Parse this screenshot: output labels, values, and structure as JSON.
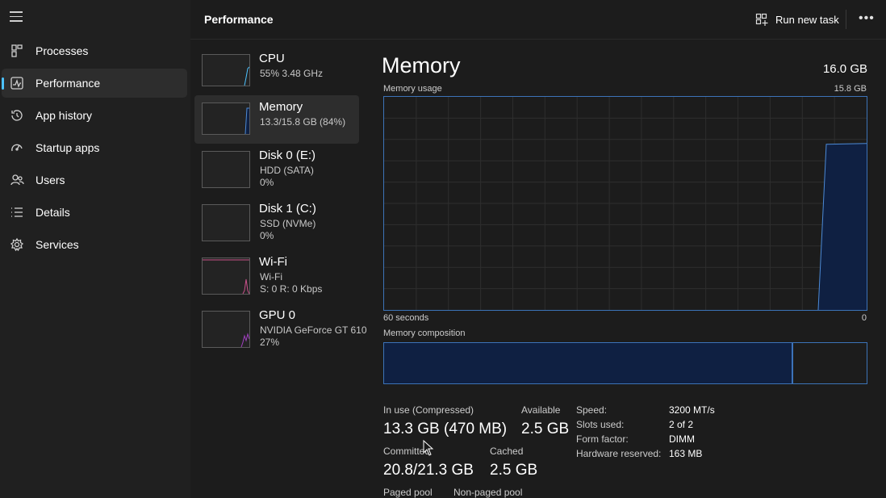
{
  "nav": {
    "items": [
      {
        "label": "Processes",
        "icon": "processes-icon"
      },
      {
        "label": "Performance",
        "icon": "performance-icon",
        "active": true
      },
      {
        "label": "App history",
        "icon": "history-icon"
      },
      {
        "label": "Startup apps",
        "icon": "startup-icon"
      },
      {
        "label": "Users",
        "icon": "users-icon"
      },
      {
        "label": "Details",
        "icon": "details-icon"
      },
      {
        "label": "Services",
        "icon": "services-icon"
      }
    ]
  },
  "header": {
    "title": "Performance",
    "run_new_task": "Run new task"
  },
  "tiles": [
    {
      "name": "CPU",
      "sub1": "55% 3.48 GHz",
      "sub2": ""
    },
    {
      "name": "Memory",
      "sub1": "13.3/15.8 GB (84%)",
      "sub2": ""
    },
    {
      "name": "Disk 0 (E:)",
      "sub1": "HDD (SATA)",
      "sub2": "0%"
    },
    {
      "name": "Disk 1 (C:)",
      "sub1": "SSD (NVMe)",
      "sub2": "0%"
    },
    {
      "name": "Wi-Fi",
      "sub1": "Wi-Fi",
      "sub2": "S: 0 R: 0 Kbps"
    },
    {
      "name": "GPU 0",
      "sub1": "NVIDIA GeForce GT 610",
      "sub2": "27%"
    }
  ],
  "memory": {
    "title": "Memory",
    "total": "16.0 GB",
    "usage_label": "Memory usage",
    "usage_max": "15.8 GB",
    "time_left": "60 seconds",
    "time_right": "0",
    "composition_label": "Memory composition",
    "in_use_fraction": 0.845
  },
  "stats": {
    "in_use_label": "In use (Compressed)",
    "in_use_value": "13.3 GB (470 MB)",
    "available_label": "Available",
    "available_value": "2.5 GB",
    "committed_label": "Committed",
    "committed_value": "20.8/21.3 GB",
    "cached_label": "Cached",
    "cached_value": "2.5 GB",
    "paged_label": "Paged pool",
    "nonpaged_label": "Non-paged pool"
  },
  "specs": {
    "speed_label": "Speed:",
    "speed_value": "3200 MT/s",
    "slots_label": "Slots used:",
    "slots_value": "2 of 2",
    "form_label": "Form factor:",
    "form_value": "DIMM",
    "reserved_label": "Hardware reserved:",
    "reserved_value": "163 MB"
  },
  "colors": {
    "accent": "#4cc2ff",
    "memory_line": "#3c73b8",
    "memory_fill": "#0f2042",
    "wifi_line": "#c8508a",
    "gpu_line": "#a040c0"
  }
}
